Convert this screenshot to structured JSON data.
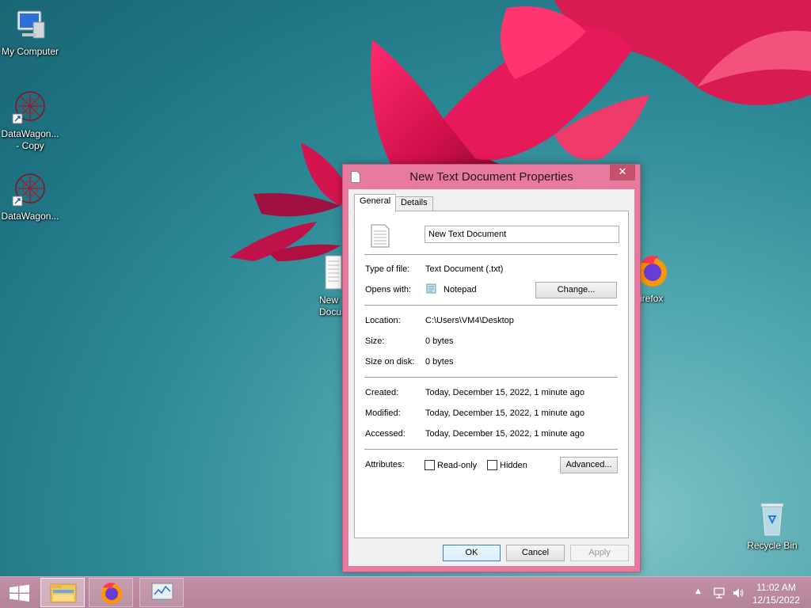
{
  "desktop": {
    "icons": [
      {
        "label": "My Computer"
      },
      {
        "label": "DataWagon...\n- Copy"
      },
      {
        "label": "DataWagon..."
      },
      {
        "label": "New\nDocum"
      },
      {
        "label": "irefox"
      },
      {
        "label": "Recycle Bin"
      }
    ]
  },
  "dialog": {
    "title": "New Text Document Properties",
    "close_label": "✕",
    "tabs": [
      {
        "label": "General",
        "active": true
      },
      {
        "label": "Details",
        "active": false
      }
    ],
    "filename": "New Text Document",
    "type_label": "Type of file:",
    "type_value": "Text Document (.txt)",
    "opens_label": "Opens with:",
    "opens_value": "Notepad",
    "change_label": "Change...",
    "location_label": "Location:",
    "location_value": "C:\\Users\\VM4\\Desktop",
    "size_label": "Size:",
    "size_value": "0 bytes",
    "size_disk_label": "Size on disk:",
    "size_disk_value": "0 bytes",
    "created_label": "Created:",
    "created_value": "Today, December 15, 2022, 1 minute ago",
    "modified_label": "Modified:",
    "modified_value": "Today, December 15, 2022, 1 minute ago",
    "accessed_label": "Accessed:",
    "accessed_value": "Today, December 15, 2022, 1 minute ago",
    "attributes_label": "Attributes:",
    "readonly_label": "Read-only",
    "hidden_label": "Hidden",
    "advanced_label": "Advanced...",
    "ok_label": "OK",
    "cancel_label": "Cancel",
    "apply_label": "Apply"
  },
  "taskbar": {
    "time": "11:02 AM",
    "date": "12/15/2022"
  },
  "colors": {
    "dialog_frame": "#e87aa0",
    "taskbar": "#b4839a",
    "desktop": "#2e8b98"
  }
}
